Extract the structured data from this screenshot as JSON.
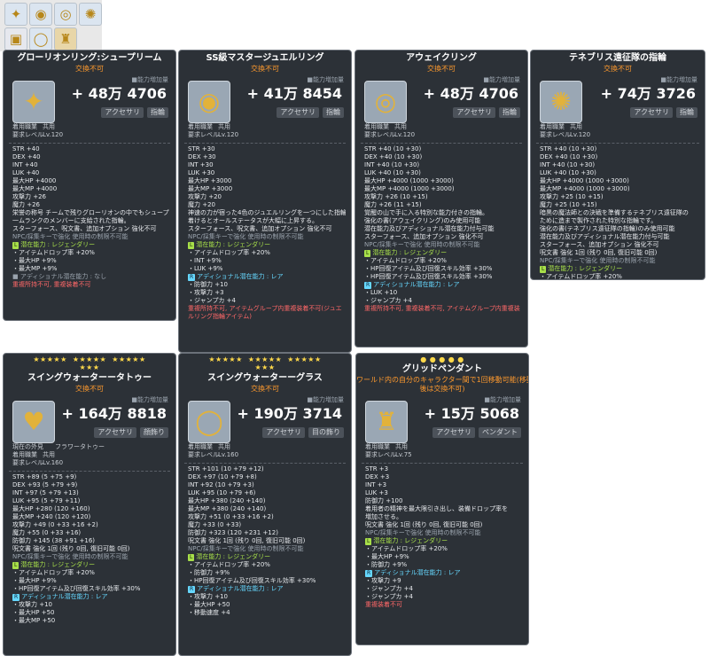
{
  "slots": [
    {
      "icon": "star-ring-icon",
      "glyph": "✦",
      "bg": "#dbe5f0"
    },
    {
      "icon": "jewel-ring-icon",
      "glyph": "◉",
      "bg": "#dbe5f0"
    },
    {
      "icon": "awake-ring-icon",
      "glyph": "◎",
      "bg": "#dbe5f0"
    },
    {
      "icon": "gold-ring-icon",
      "glyph": "✺",
      "bg": "#dbe5f0"
    },
    {
      "icon": "tattoo-icon",
      "glyph": "▣",
      "bg": "#e6e8ee"
    },
    {
      "icon": "glass-icon",
      "glyph": "◯",
      "bg": "#dbe5f0"
    },
    {
      "icon": "pendant-icon",
      "glyph": "♜",
      "bg": "#e8d6a8"
    }
  ],
  "panels": [
    {
      "name": "グローリオンリング:シュープリーム",
      "sub": "交換不可",
      "compare": "■能力増加量",
      "icon": "gold-star-ring-icon",
      "glyph": "✦",
      "plus": "+ 48万 4706",
      "tags": [
        "アクセサリ",
        "指輪"
      ],
      "meta": [
        [
          "着用職業",
          "共用"
        ],
        [
          "要求レベル",
          "Lv.120"
        ]
      ],
      "lines": [
        [
          "c-stat",
          "STR  +40"
        ],
        [
          "c-stat",
          "DEX  +40"
        ],
        [
          "c-stat",
          "INT  +40"
        ],
        [
          "c-stat",
          "LUK  +40"
        ],
        [
          "c-stat",
          "最大HP  +4000"
        ],
        [
          "c-stat",
          "最大MP  +4000"
        ],
        [
          "c-stat",
          "攻撃力  +26"
        ],
        [
          "c-stat",
          "魔力  +26"
        ],
        [
          "c-desc",
          "栄誉の称号 チームで残りグローリオンの中でもシュープリ"
        ],
        [
          "c-desc",
          "一ムランクのメンバーに支給された指輪。"
        ],
        [
          "c-desc",
          "スターフォース、呪文書、追加オプション 強化不可"
        ],
        [
          "c-gray",
          "NPC/採集キーで強化 使用時の制限不可能"
        ],
        [
          "c-leg",
          "潜在能力 : レジェンダリー",
          "gy",
          "L"
        ],
        [
          "c-stat",
          "・アイテムドロップ率 +20%"
        ],
        [
          "c-stat",
          "・最大HP +9%"
        ],
        [
          "c-stat",
          "・最大MP +9%"
        ],
        [
          "c-gray",
          "■ アディショナル潜在能力 : なし"
        ],
        [
          "c-red",
          "重複所持不可, 重複装着不可"
        ]
      ]
    },
    {
      "name": "SS級マスタージュエルリング",
      "sub": "交換不可",
      "compare": "■能力増加量",
      "icon": "jewel-ring-icon",
      "glyph": "◉",
      "plus": "+ 41万 8454",
      "tags": [
        "アクセサリ",
        "指輪"
      ],
      "meta": [
        [
          "着用職業",
          "共用"
        ],
        [
          "要求レベル",
          "Lv.120"
        ]
      ],
      "lines": [
        [
          "c-stat",
          "STR  +30"
        ],
        [
          "c-stat",
          "DEX  +30"
        ],
        [
          "c-stat",
          "INT  +30"
        ],
        [
          "c-stat",
          "LUK  +30"
        ],
        [
          "c-stat",
          "最大HP  +3000"
        ],
        [
          "c-stat",
          "最大MP  +3000"
        ],
        [
          "c-stat",
          "攻撃力  +20"
        ],
        [
          "c-stat",
          "魔力  +20"
        ],
        [
          "c-desc",
          "神速の力が宿った4色のジュエルリングを一つにした指輪。"
        ],
        [
          "c-desc",
          "着けるとオールステータスが大幅に上昇する。"
        ],
        [
          "c-desc",
          "スターフォース、呪文書、追加オプション 強化不可"
        ],
        [
          "c-gray",
          "NPC/採集キーで強化 使用時の制限不可能"
        ],
        [
          "c-leg",
          "潜在能力 : レジェンダリー",
          "gy",
          "L"
        ],
        [
          "c-stat",
          "・アイテムドロップ率 +20%"
        ],
        [
          "c-stat",
          "・INT +9%"
        ],
        [
          "c-stat",
          "・LUK +9%"
        ],
        [
          "c-rare",
          "アディショナル潜在能力 : レア",
          "bl",
          "R"
        ],
        [
          "c-stat",
          "・防御力 +10"
        ],
        [
          "c-stat",
          "・攻撃力 +3"
        ],
        [
          "c-stat",
          "・ジャンプカ +4"
        ],
        [
          "c-red",
          "重複所持不可, アイテムグループ内重複装着不可(ジュエ"
        ],
        [
          "c-red",
          "ルリング指輪アイテム)"
        ]
      ]
    },
    {
      "name": "アウェイクリング",
      "sub": "交換不可",
      "compare": "■能力増加量",
      "icon": "awake-ring-icon",
      "glyph": "◎",
      "plus": "+ 48万 4706",
      "tags": [
        "アクセサリ",
        "指輪"
      ],
      "meta": [
        [
          "着用職業",
          "共用"
        ],
        [
          "要求レベル",
          "Lv.120"
        ]
      ],
      "lines": [
        [
          "c-stat",
          "STR  +40 (10 +30)"
        ],
        [
          "c-stat",
          "DEX  +40 (10 +30)"
        ],
        [
          "c-stat",
          "INT  +40 (10 +30)"
        ],
        [
          "c-stat",
          "LUK  +40 (10 +30)"
        ],
        [
          "c-stat",
          "最大HP  +4000 (1000 +3000)"
        ],
        [
          "c-stat",
          "最大MP  +4000 (1000 +3000)"
        ],
        [
          "c-stat",
          "攻撃力  +26 (10 +15)"
        ],
        [
          "c-stat",
          "魔力  +26 (11 +15)"
        ],
        [
          "c-desc",
          "覚醒の山で手に入る特別な能力付きの指輪。"
        ],
        [
          "c-desc",
          "強化の書(アウェイクリング)のみ使用可能"
        ],
        [
          "c-desc",
          "潜在能力及びアディショナル潜在能力付与可能"
        ],
        [
          "c-desc",
          "スターフォース、追加オプション 強化不可"
        ],
        [
          "c-gray",
          "NPC/採集キーで強化 使用時の制限不可能"
        ],
        [
          "c-leg",
          "潜在能力 : レジェンダリー",
          "gy",
          "L"
        ],
        [
          "c-stat",
          "・アイテムドロップ率 +20%"
        ],
        [
          "c-stat",
          "・HP回復アイテム及び回復スキル効率 +30%"
        ],
        [
          "c-stat",
          "・HP回復アイテム及び回復スキル効率 +30%"
        ],
        [
          "c-rare",
          "アディショナル潜在能力 : レア",
          "bl",
          "R"
        ],
        [
          "c-stat",
          "・LUK +10"
        ],
        [
          "c-stat",
          "・ジャンプカ +4"
        ],
        [
          "c-red",
          "重複所持不可, 重複装着不可, アイテムグループ内重複装"
        ]
      ]
    },
    {
      "name": "テネブリス遠征隊の指輪",
      "sub": "交換不可",
      "compare": "■能力増加量",
      "icon": "tenebris-ring-icon",
      "glyph": "✺",
      "plus": "+ 74万 3726",
      "tags": [
        "アクセサリ",
        "指輪"
      ],
      "meta": [
        [
          "着用職業",
          "共用"
        ],
        [
          "要求レベル",
          "Lv.120"
        ]
      ],
      "lines": [
        [
          "c-stat",
          "STR  +40 (10 +30)"
        ],
        [
          "c-stat",
          "DEX  +40 (10 +30)"
        ],
        [
          "c-stat",
          "INT  +40 (10 +30)"
        ],
        [
          "c-stat",
          "LUK  +40 (10 +30)"
        ],
        [
          "c-stat",
          "最大HP  +4000 (1000 +3000)"
        ],
        [
          "c-stat",
          "最大MP  +4000 (1000 +3000)"
        ],
        [
          "c-stat",
          "攻撃力  +25 (10 +15)"
        ],
        [
          "c-stat",
          "魔力  +25 (10 +15)"
        ],
        [
          "c-desc",
          "暗黒の魔法師との決戦を準備するテネブリス遠征隊の"
        ],
        [
          "c-desc",
          "ために造まで製作された特別な指輪です。"
        ],
        [
          "c-desc",
          "強化の書(テネブリス遠征隊の指輪)のみ使用可能"
        ],
        [
          "c-desc",
          "潜在能力及びアディショナル潜在能力付与可能"
        ],
        [
          "c-desc",
          "スターフォース、追加オプション 強化不可"
        ],
        [
          "c-desc",
          "呪文書 強化 1回 (残り 0回, 復旧可能 0回)"
        ],
        [
          "c-gray",
          "NPC/採集キーで強化 使用時の制限不可能"
        ],
        [
          "c-leg",
          "潜在能力 : レジェンダリー",
          "gy",
          "L"
        ],
        [
          "c-stat",
          "・アイテムドロップ率 +20%"
        ],
        [
          "c-stat",
          "・INT +9%"
        ],
        [
          "c-stat",
          "・INT +9%"
        ],
        [
          "c-rare",
          "アディショナル潜在能力 : レア",
          "bl",
          "R"
        ],
        [
          "c-stat",
          "・攻撃力 +10"
        ],
        [
          "c-stat",
          "・STR +6"
        ],
        [
          "c-stat",
          "・最大MP +50"
        ]
      ]
    },
    {
      "stars": "★★★★★  ★★★★★  ★★★★★\n★★★",
      "name": "スイングウォーターータトゥー",
      "sub": "交換不可",
      "compare": "■能力増加量",
      "icon": "tattoo-icon",
      "glyph": "♥",
      "plus": "+ 164万 8818",
      "tags": [
        "アクセサリ",
        "顔飾り"
      ],
      "meta": [
        [
          "現在の外見",
          "フラワータトゥー"
        ],
        [
          "着用職業",
          "共用"
        ],
        [
          "要求レベル",
          "Lv.160"
        ]
      ],
      "lines": [
        [
          "c-stat",
          "STR  +89 (5 +75 +9)"
        ],
        [
          "c-stat",
          "DEX  +93 (5 +79 +9)"
        ],
        [
          "c-stat",
          "INT  +97 (5 +79 +13)"
        ],
        [
          "c-stat",
          "LUK  +95 (5 +79 +11)"
        ],
        [
          "c-stat",
          "最大HP  +280 (120 +160)"
        ],
        [
          "c-stat",
          "最大MP  +240 (120 +120)"
        ],
        [
          "c-stat",
          "攻撃力  +49 (0 +33 +16 +2)"
        ],
        [
          "c-stat",
          "魔力  +55 (0 +33 +16)"
        ],
        [
          "c-stat",
          "防御力  +145 (38 +91 +16)"
        ],
        [
          "c-desc",
          "呪文書 強化 1回 (残り 0回, 復旧可能 0回)"
        ],
        [
          "c-gray",
          "NPC/採集キーで強化 使用時の制限不可能"
        ],
        [
          "c-leg",
          "潜在能力 : レジェンダリー",
          "gy",
          "L"
        ],
        [
          "c-stat",
          "・アイテムドロップ率 +20%"
        ],
        [
          "c-stat",
          "・最大HP +9%"
        ],
        [
          "c-stat",
          "・HP回復アイテム及び回復スキル効率 +30%"
        ],
        [
          "c-rare",
          "アディショナル潜在能力 : レア",
          "bl",
          "R"
        ],
        [
          "c-stat",
          "・攻撃力 +10"
        ],
        [
          "c-stat",
          "・最大HP +50"
        ],
        [
          "c-stat",
          "・最大MP +50"
        ]
      ]
    },
    {
      "stars": "★★★★★  ★★★★★  ★★★★★\n★★★",
      "name": "スイングウォーターーグラス",
      "sub": "交換不可",
      "compare": "■能力増加量",
      "icon": "glass-icon",
      "glyph": "◯",
      "plus": "+ 190万 3714",
      "tags": [
        "アクセサリ",
        "目の飾り"
      ],
      "meta": [
        [
          "着用職業",
          "共用"
        ],
        [
          "要求レベル",
          "Lv.160"
        ]
      ],
      "lines": [
        [
          "c-stat",
          "STR  +101 (10 +79 +12)"
        ],
        [
          "c-stat",
          "DEX  +97 (10 +79 +8)"
        ],
        [
          "c-stat",
          "INT  +92 (10 +79 +3)"
        ],
        [
          "c-stat",
          "LUK  +95 (10 +79 +6)"
        ],
        [
          "c-stat",
          "最大HP  +380 (240 +140)"
        ],
        [
          "c-stat",
          "最大MP  +380 (240 +140)"
        ],
        [
          "c-stat",
          "攻撃力  +51 (0 +33 +16 +2)"
        ],
        [
          "c-stat",
          "魔力  +33 (0 +33)"
        ],
        [
          "c-stat",
          "防御力  +323 (120 +231 +12)"
        ],
        [
          "c-desc",
          "呪文書 強化 1回 (残り 0回, 復旧可能 0回)"
        ],
        [
          "c-gray",
          "NPC/採集キーで強化 使用時の制限不可能"
        ],
        [
          "c-leg",
          "潜在能力 : レジェンダリー",
          "gy",
          "L"
        ],
        [
          "c-stat",
          "・アイテムドロップ率 +20%"
        ],
        [
          "c-stat",
          "・防御力 +9%"
        ],
        [
          "c-stat",
          "・HP回復アイテム及び回復スキル効率 +30%"
        ],
        [
          "c-rare",
          "アディショナル潜在能力 : レア",
          "bl",
          "R"
        ],
        [
          "c-stat",
          "・攻撃力 +10"
        ],
        [
          "c-stat",
          "・最大HP +50"
        ],
        [
          "c-stat",
          "・移動速度 +4"
        ]
      ]
    },
    {
      "stars": "● ● ● ● ●",
      "name": "グリッドペンダント",
      "pub": "ワールド内の自分のキャラクター間で1回移動可能(移動",
      "sub": "後は交換不可)",
      "compare": "■能力増加量",
      "icon": "pendant-icon",
      "glyph": "♜",
      "plus": "+ 15万 5068",
      "tags": [
        "アクセサリ",
        "ペンダント"
      ],
      "meta": [
        [
          "着用職業",
          "共用"
        ],
        [
          "要求レベル",
          "Lv.75"
        ]
      ],
      "lines": [
        [
          "c-stat",
          "STR  +3"
        ],
        [
          "c-stat",
          "DEX  +3"
        ],
        [
          "c-stat",
          "INT  +3"
        ],
        [
          "c-stat",
          "LUK  +3"
        ],
        [
          "c-stat",
          "防御力  +100"
        ],
        [
          "c-desc",
          "着用者の精神を最大限引き出し、装備ドロップ率を"
        ],
        [
          "c-desc",
          "増加させる。"
        ],
        [
          "c-desc",
          "呪文書 強化 1回 (残り 0回, 復旧可能 0回)"
        ],
        [
          "c-gray",
          "NPC/採集キーで強化 使用時の制限不可能"
        ],
        [
          "c-leg",
          "潜在能力 : レジェンダリー",
          "gy",
          "L"
        ],
        [
          "c-stat",
          "・アイテムドロップ率 +20%"
        ],
        [
          "c-stat",
          "・最大HP +9%"
        ],
        [
          "c-stat",
          "・防御力 +9%"
        ],
        [
          "c-rare",
          "アディショナル潜在能力 : レア",
          "bl",
          "R"
        ],
        [
          "c-stat",
          "・攻撃力 +9"
        ],
        [
          "c-stat",
          "・ジャンプカ +4"
        ],
        [
          "c-stat",
          "・ジャンプカ +4"
        ],
        [
          "c-red",
          "重複装着不可"
        ]
      ]
    }
  ]
}
